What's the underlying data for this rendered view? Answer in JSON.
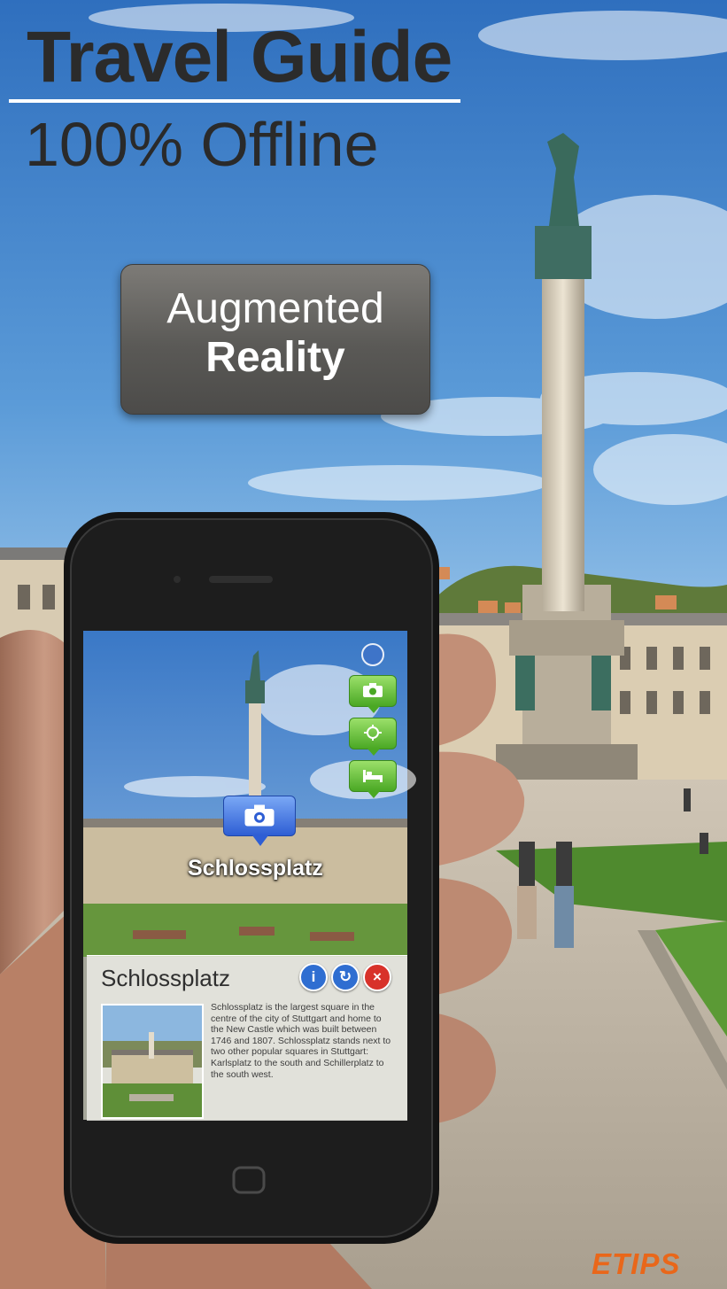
{
  "headline": {
    "title": "Travel Guide",
    "subtitle": "100% Offline"
  },
  "feature_badge": {
    "line1": "Augmented",
    "line2": "Reality"
  },
  "ar_view": {
    "poi_label": "Schlossplatz",
    "poi_icon": "camera-icon",
    "category_icons": [
      "camera-icon",
      "sightseeing-icon",
      "hotel-icon"
    ],
    "info_icon": "info-icon"
  },
  "info_panel": {
    "title": "Schlossplatz",
    "buttons": {
      "info": "i",
      "share": "↻",
      "close": "×"
    },
    "description": "Schlossplatz is the largest square in the centre of the city of Stuttgart and home to the New Castle which was built between 1746 and 1807. Schlossplatz stands next to two other popular squares in Stuttgart: Karlsplatz to the south and Schillerplatz to the south west."
  },
  "brand": {
    "logo": "ETIPS"
  },
  "colors": {
    "sky": "#3f82cc",
    "badge": "#5a5956",
    "marker_blue": "#2e5ed4",
    "ar_green": "#4aa824",
    "brand_orange": "#e9671a"
  }
}
